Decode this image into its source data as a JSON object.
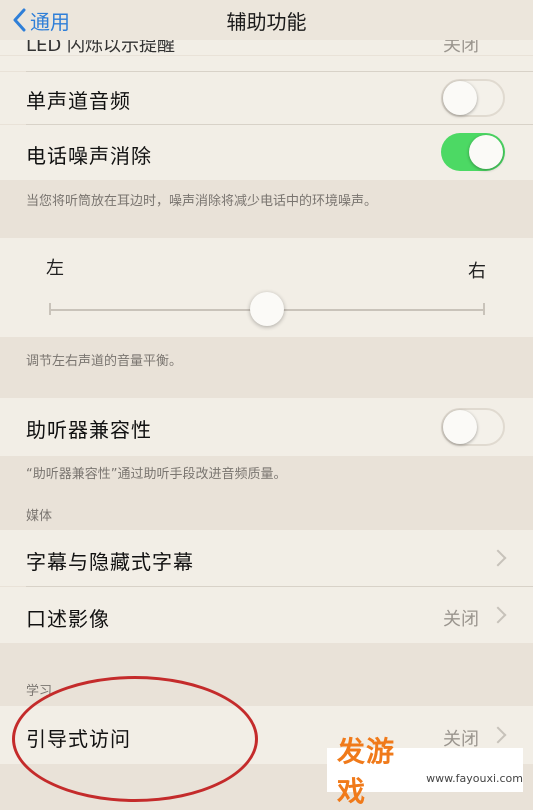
{
  "nav": {
    "back_label": "通用",
    "title": "辅助功能"
  },
  "peek": {
    "label": "LED 闪烁以示提醒",
    "value": "关闭"
  },
  "audio": {
    "mono_label": "单声道音频",
    "mono_on": false,
    "noise_label": "电话噪声消除",
    "noise_on": true,
    "noise_footer": "当您将听筒放在耳边时，噪声消除将减少电话中的环境噪声。"
  },
  "balance": {
    "left": "左",
    "right": "右",
    "value_fraction": 0.5,
    "footer": "调节左右声道的音量平衡。"
  },
  "hearing": {
    "label": "助听器兼容性",
    "on": false,
    "footer": "“助听器兼容性”通过助听手段改进音频质量。"
  },
  "media": {
    "header": "媒体",
    "subtitles_label": "字幕与隐藏式字幕",
    "audio_desc_label": "口述影像",
    "audio_desc_value": "关闭"
  },
  "learning": {
    "header": "学习",
    "guided_label": "引导式访问",
    "guided_value": "关闭"
  },
  "watermark": {
    "text": "发游戏",
    "url": "www.fayouxi.com"
  },
  "colors": {
    "accent": "#2f7fd8",
    "toggle_on": "#4cd964",
    "annotation": "#c42b2b"
  }
}
